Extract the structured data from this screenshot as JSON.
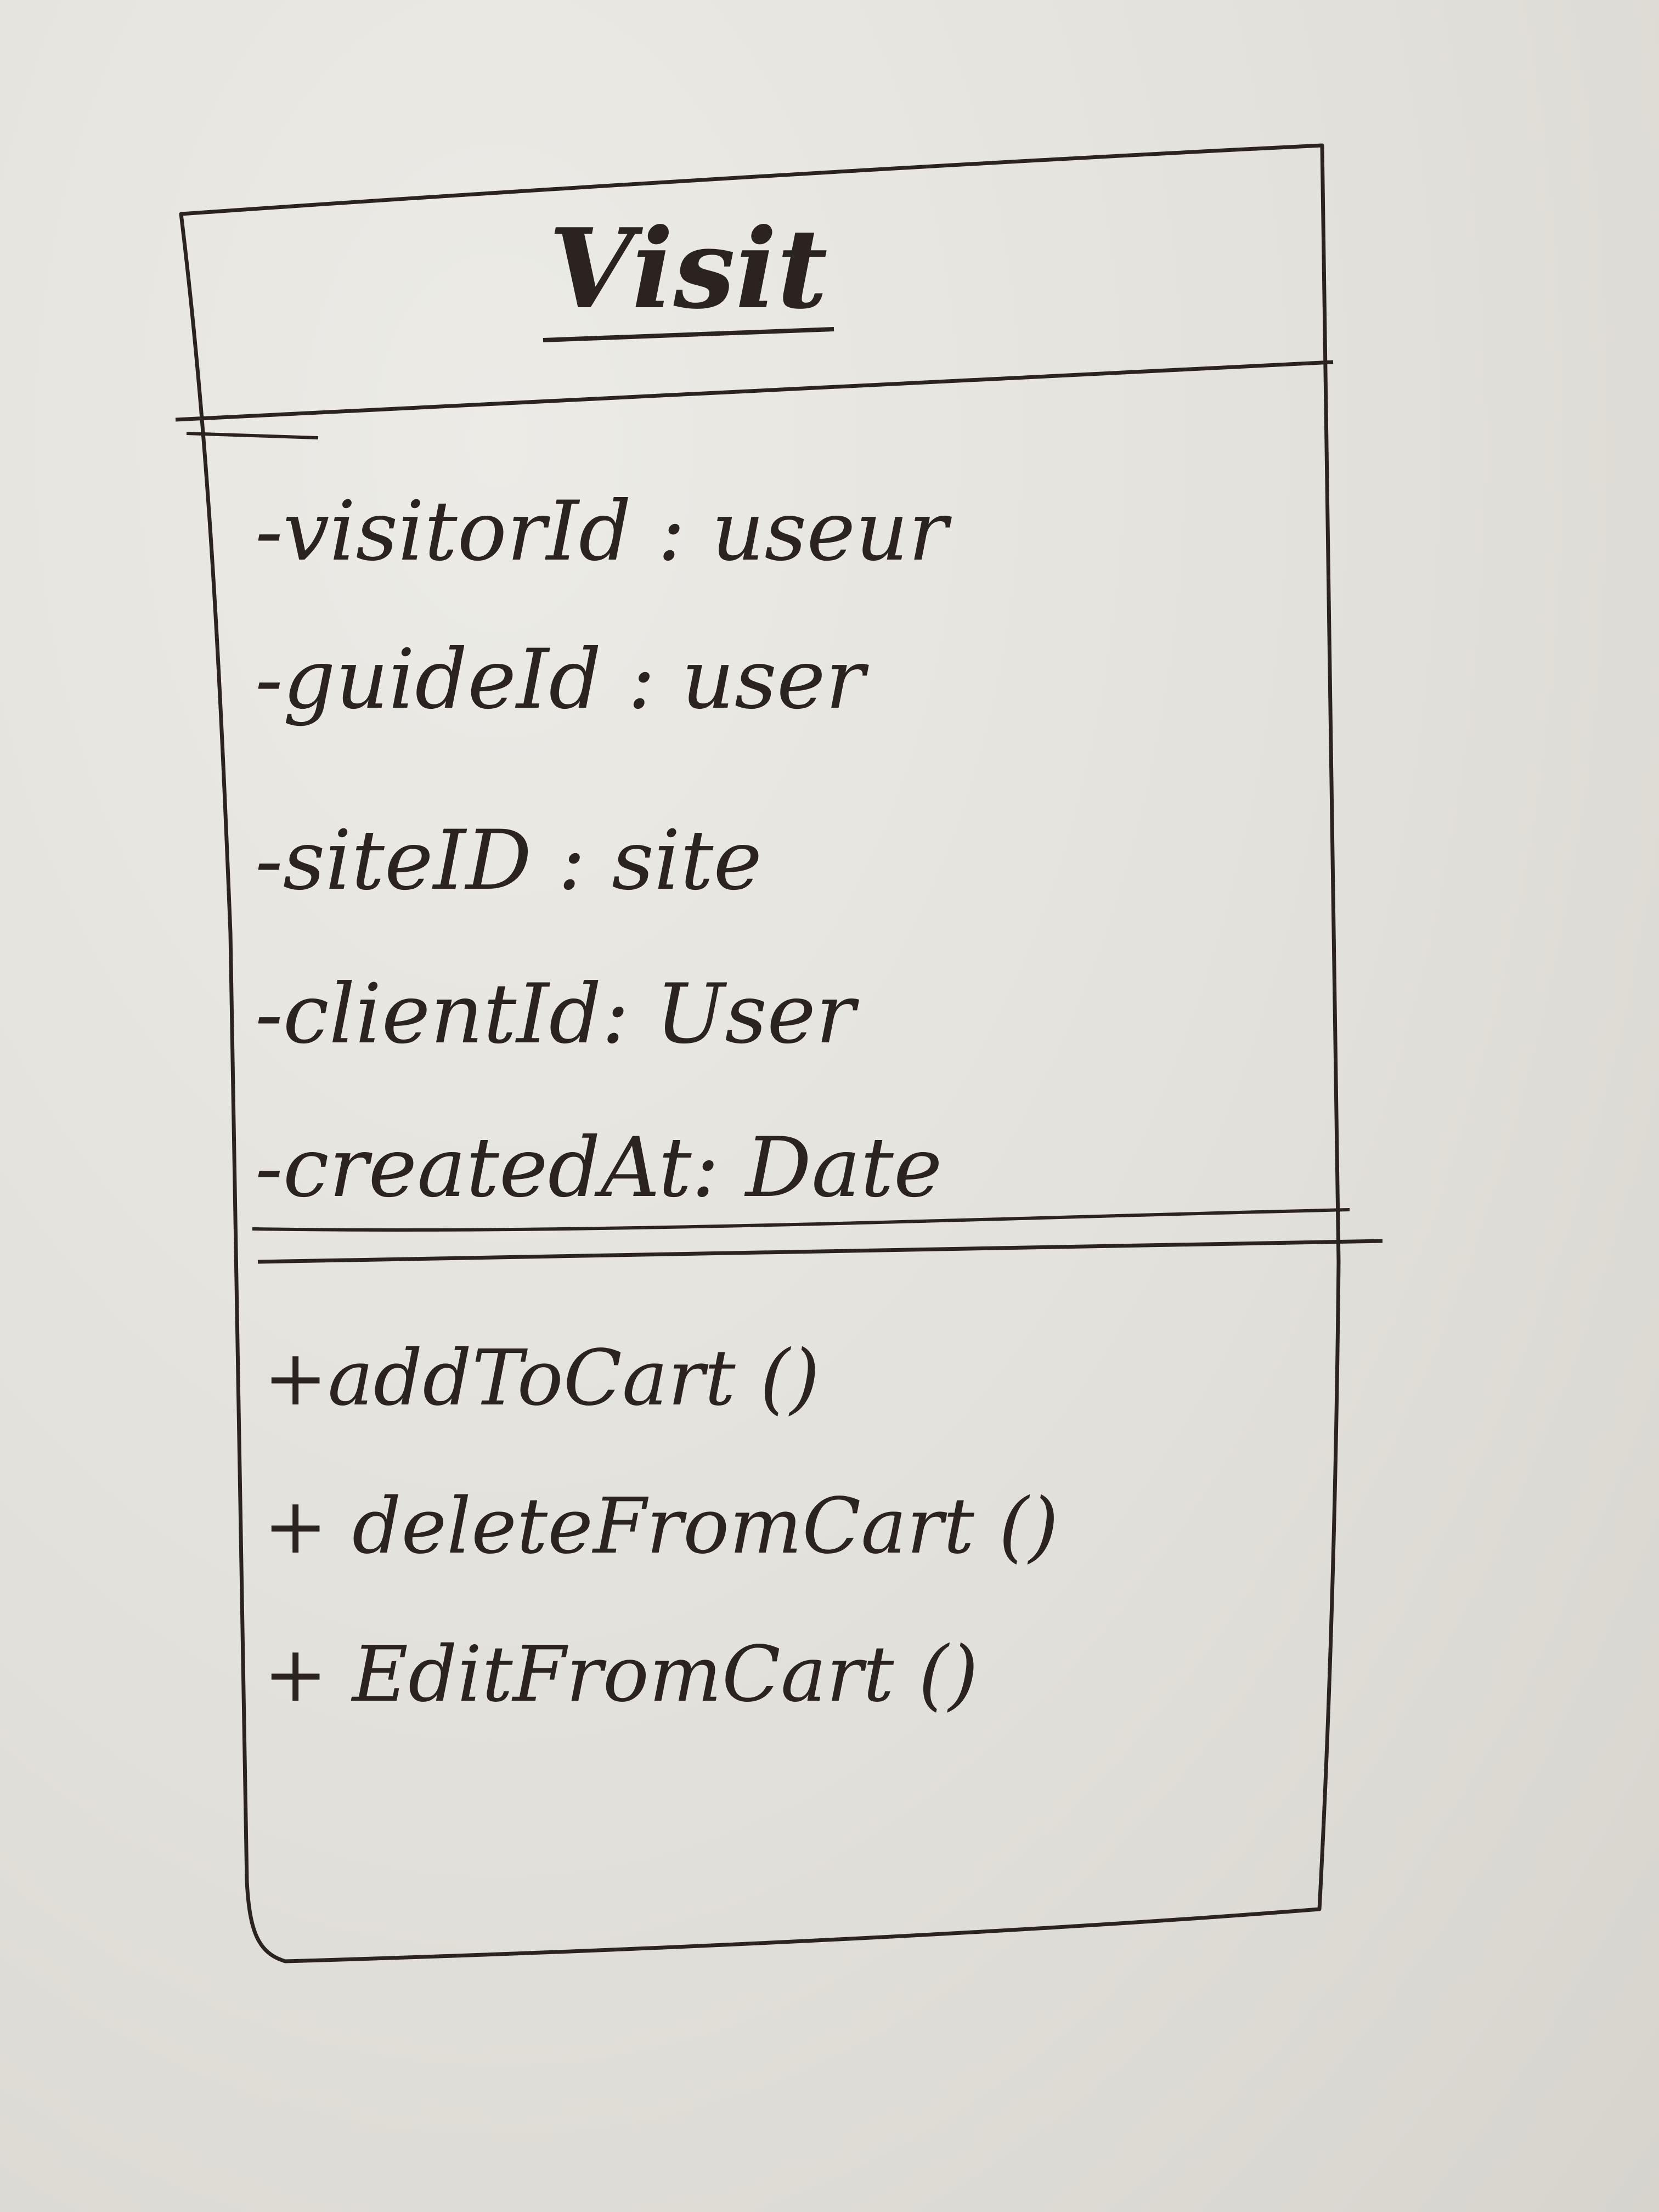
{
  "class_diagram": {
    "class_name": "Visit",
    "attributes": [
      {
        "visibility": "-",
        "name": "visitorId",
        "type": "useur"
      },
      {
        "visibility": "-",
        "name": "guideId",
        "type": "user"
      },
      {
        "visibility": "-",
        "name": "siteID",
        "type": "site"
      },
      {
        "visibility": "-",
        "name": "clientId",
        "type": "User"
      },
      {
        "visibility": "-",
        "name": "createdAt",
        "type": "Date"
      }
    ],
    "methods": [
      {
        "visibility": "+",
        "name": "addToCart",
        "params": "()"
      },
      {
        "visibility": "+",
        "name": "deleteFromCart",
        "params": "()"
      },
      {
        "visibility": "+",
        "name": "EditFromCart",
        "params": "()"
      }
    ]
  },
  "colors": {
    "ink": "#2a2320",
    "paper": "#e4e2dc"
  }
}
